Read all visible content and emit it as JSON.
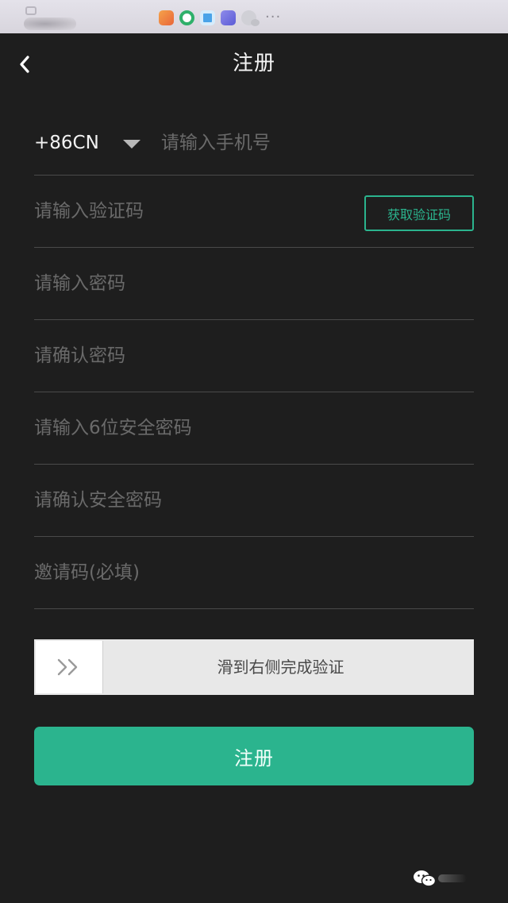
{
  "status_bar": {
    "apps": [
      "uc-browser-icon",
      "360-browser-icon",
      "qq-browser-icon",
      "music-icon",
      "wechat-icon"
    ],
    "more": "···"
  },
  "nav": {
    "title": "注册"
  },
  "form": {
    "country_code": "+86CN",
    "phone_placeholder": "请输入手机号",
    "code_placeholder": "请输入验证码",
    "get_code_label": "获取验证码",
    "password_placeholder": "请输入密码",
    "confirm_password_placeholder": "请确认密码",
    "safe_password_placeholder": "请输入6位安全密码",
    "confirm_safe_password_placeholder": "请确认安全密码",
    "invite_placeholder": "邀请码(必填)"
  },
  "slider": {
    "text": "滑到右侧完成验证",
    "progress": 0
  },
  "submit": {
    "label": "注册"
  },
  "colors": {
    "background": "#1e1e1e",
    "accent": "#2bb48e",
    "divider": "#4a4a4a",
    "placeholder": "#6a6a6a",
    "slider_track": "#e8e8e8"
  }
}
